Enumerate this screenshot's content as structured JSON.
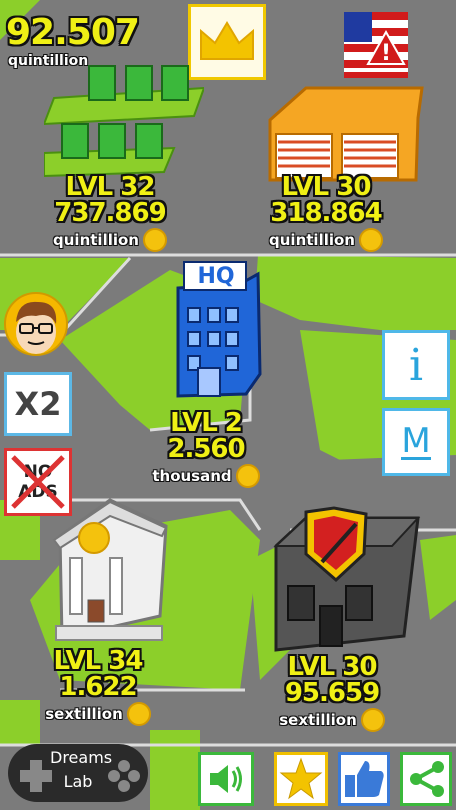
{
  "balance": {
    "value": "92.507",
    "unit": "quintillion"
  },
  "buildings": [
    {
      "lvl": "LVL 32",
      "value": "737.869",
      "unit": "quintillion"
    },
    {
      "lvl": "LVL 30",
      "value": "318.864",
      "unit": "quintillion"
    },
    {
      "lvl": "LVL 2",
      "value": "2.560",
      "unit": "thousand"
    },
    {
      "lvl": "LVL 34",
      "value": "1.622",
      "unit": "sextillion"
    },
    {
      "lvl": "LVL 30",
      "value": "95.659",
      "unit": "sextillion"
    }
  ],
  "hq_sign": "HQ",
  "side_buttons": {
    "x2": "X2",
    "no_ads": "NO ADS"
  },
  "right_buttons": {
    "info": "i",
    "stats": "M"
  },
  "dreams_lab": {
    "line1": "Dreams",
    "line2": "Lab"
  },
  "colors": {
    "grass": "#8ccf2a",
    "road": "#7a7a7a",
    "value_text": "#f0f015",
    "coin": "#f4c20d"
  }
}
